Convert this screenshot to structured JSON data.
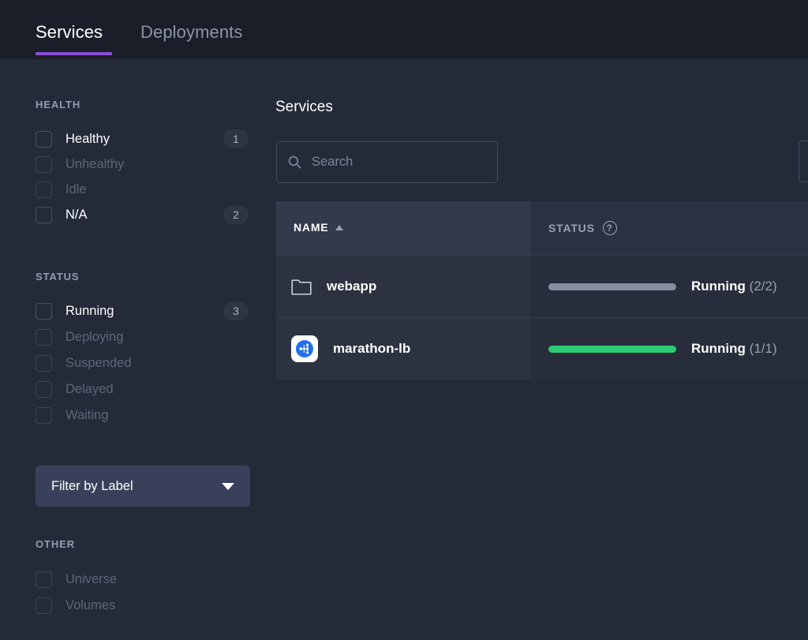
{
  "tabs": [
    {
      "label": "Services",
      "active": true
    },
    {
      "label": "Deployments",
      "active": false
    }
  ],
  "sidebar": {
    "health": {
      "title": "HEALTH",
      "items": [
        {
          "label": "Healthy",
          "count": "1",
          "enabled": true
        },
        {
          "label": "Unhealthy",
          "count": "",
          "enabled": false
        },
        {
          "label": "Idle",
          "count": "",
          "enabled": false
        },
        {
          "label": "N/A",
          "count": "2",
          "enabled": true
        }
      ]
    },
    "status": {
      "title": "STATUS",
      "items": [
        {
          "label": "Running",
          "count": "3",
          "enabled": true
        },
        {
          "label": "Deploying",
          "count": "",
          "enabled": false
        },
        {
          "label": "Suspended",
          "count": "",
          "enabled": false
        },
        {
          "label": "Delayed",
          "count": "",
          "enabled": false
        },
        {
          "label": "Waiting",
          "count": "",
          "enabled": false
        }
      ]
    },
    "label_filter": {
      "label": "Filter by Label",
      "icon": "chevron-down-icon"
    },
    "other": {
      "title": "OTHER",
      "items": [
        {
          "label": "Universe",
          "count": "",
          "enabled": false
        },
        {
          "label": "Volumes",
          "count": "",
          "enabled": false
        }
      ]
    }
  },
  "main": {
    "title": "Services",
    "search": {
      "placeholder": "Search",
      "value": "",
      "icon": "search-icon"
    },
    "table": {
      "columns": [
        {
          "label": "NAME",
          "sorted": true,
          "sort_direction": "asc"
        },
        {
          "label": "STATUS",
          "sorted": false,
          "help_icon": "question-mark-icon"
        }
      ],
      "rows": [
        {
          "name": "webapp",
          "icon": "folder-icon",
          "status_text": "Running",
          "status_count": "(2/2)",
          "bar_color": "#868d9e",
          "bar_fill": 100
        },
        {
          "name": "marathon-lb",
          "icon": "marathon-lb-app-icon",
          "status_text": "Running",
          "status_count": "(1/1)",
          "bar_color": "#2dca73",
          "bar_fill": 100
        }
      ]
    }
  },
  "colors": {
    "accent": "#8a4ed8",
    "topbar_bg": "#1a1e28",
    "body_bg": "#242a38",
    "running_green": "#2dca73",
    "neutral_gray": "#868d9e"
  }
}
